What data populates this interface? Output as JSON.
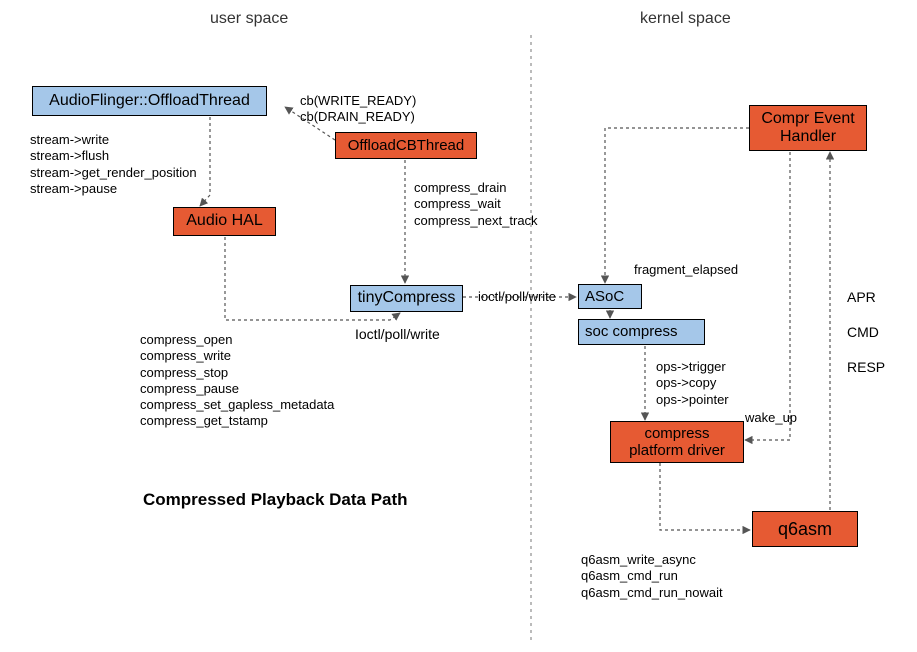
{
  "headings": {
    "user_space": "user space",
    "kernel_space": "kernel space"
  },
  "title": "Compressed Playback Data Path",
  "nodes": {
    "audioflinger": "AudioFlinger::OffloadThread",
    "audio_hal": "Audio HAL",
    "offload_cb": "OffloadCBThread",
    "tinycompress": "tinyCompress",
    "compr_event_handler": "Compr Event\nHandler",
    "asoc": "ASoC",
    "soc_compress": "soc compress",
    "compress_platform_driver": "compress\nplatform driver",
    "q6asm": "q6asm"
  },
  "labels": {
    "cb_calls": "cb(WRITE_READY)\ncb(DRAIN_READY)",
    "stream_calls": "stream->write\nstream->flush\nstream->get_render_position\nstream->pause",
    "offload_to_tiny": "compress_drain\ncompress_wait\ncompress_next_track",
    "hal_to_tiny": "compress_open\ncompress_write\ncompress_stop\ncompress_pause\ncompress_set_gapless_metadata\ncompress_get_tstamp",
    "ioctl_poll_write_left": "Ioctl/poll/write",
    "ioctl_poll_write_right": "ioctl/poll/write",
    "fragment_elapsed": "fragment_elapsed",
    "ops_calls": "ops->trigger\nops->copy\nops->pointer",
    "wake_up": "wake_up",
    "q6asm_calls": "q6asm_write_async\nq6asm_cmd_run\nq6asm_cmd_run_nowait",
    "apr_cmd_resp": "APR\n\nCMD\n\nRESP"
  }
}
